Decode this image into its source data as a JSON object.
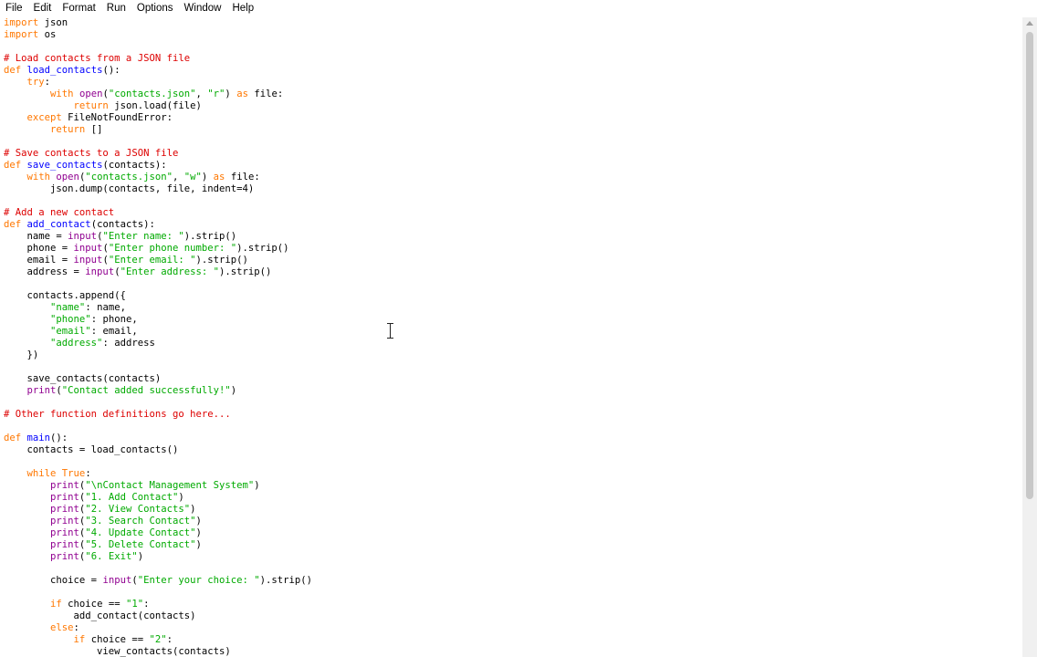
{
  "menu": [
    "File",
    "Edit",
    "Format",
    "Run",
    "Options",
    "Window",
    "Help"
  ],
  "code_lines": [
    [
      [
        "kw",
        "import"
      ],
      [
        "p",
        " json"
      ]
    ],
    [
      [
        "kw",
        "import"
      ],
      [
        "p",
        " os"
      ]
    ],
    [],
    [
      [
        "cm",
        "# Load contacts from a JSON file"
      ]
    ],
    [
      [
        "kw",
        "def"
      ],
      [
        "p",
        " "
      ],
      [
        "fn",
        "load_contacts"
      ],
      [
        "p",
        "():"
      ]
    ],
    [
      [
        "p",
        "    "
      ],
      [
        "kw",
        "try"
      ],
      [
        "p",
        ":"
      ]
    ],
    [
      [
        "p",
        "        "
      ],
      [
        "kw",
        "with"
      ],
      [
        "p",
        " "
      ],
      [
        "bi",
        "open"
      ],
      [
        "p",
        "("
      ],
      [
        "st",
        "\"contacts.json\""
      ],
      [
        "p",
        ", "
      ],
      [
        "st",
        "\"r\""
      ],
      [
        "p",
        ") "
      ],
      [
        "kw",
        "as"
      ],
      [
        "p",
        " file:"
      ]
    ],
    [
      [
        "p",
        "            "
      ],
      [
        "kw",
        "return"
      ],
      [
        "p",
        " json.load(file)"
      ]
    ],
    [
      [
        "p",
        "    "
      ],
      [
        "kw",
        "except"
      ],
      [
        "p",
        " FileNotFoundError:"
      ]
    ],
    [
      [
        "p",
        "        "
      ],
      [
        "kw",
        "return"
      ],
      [
        "p",
        " []"
      ]
    ],
    [],
    [
      [
        "cm",
        "# Save contacts to a JSON file"
      ]
    ],
    [
      [
        "kw",
        "def"
      ],
      [
        "p",
        " "
      ],
      [
        "fn",
        "save_contacts"
      ],
      [
        "p",
        "(contacts):"
      ]
    ],
    [
      [
        "p",
        "    "
      ],
      [
        "kw",
        "with"
      ],
      [
        "p",
        " "
      ],
      [
        "bi",
        "open"
      ],
      [
        "p",
        "("
      ],
      [
        "st",
        "\"contacts.json\""
      ],
      [
        "p",
        ", "
      ],
      [
        "st",
        "\"w\""
      ],
      [
        "p",
        ") "
      ],
      [
        "kw",
        "as"
      ],
      [
        "p",
        " file:"
      ]
    ],
    [
      [
        "p",
        "        json.dump(contacts, file, indent=4)"
      ]
    ],
    [],
    [
      [
        "cm",
        "# Add a new contact"
      ]
    ],
    [
      [
        "kw",
        "def"
      ],
      [
        "p",
        " "
      ],
      [
        "fn",
        "add_contact"
      ],
      [
        "p",
        "(contacts):"
      ]
    ],
    [
      [
        "p",
        "    name = "
      ],
      [
        "bi",
        "input"
      ],
      [
        "p",
        "("
      ],
      [
        "st",
        "\"Enter name: \""
      ],
      [
        "p",
        ").strip()"
      ]
    ],
    [
      [
        "p",
        "    phone = "
      ],
      [
        "bi",
        "input"
      ],
      [
        "p",
        "("
      ],
      [
        "st",
        "\"Enter phone number: \""
      ],
      [
        "p",
        ").strip()"
      ]
    ],
    [
      [
        "p",
        "    email = "
      ],
      [
        "bi",
        "input"
      ],
      [
        "p",
        "("
      ],
      [
        "st",
        "\"Enter email: \""
      ],
      [
        "p",
        ").strip()"
      ]
    ],
    [
      [
        "p",
        "    address = "
      ],
      [
        "bi",
        "input"
      ],
      [
        "p",
        "("
      ],
      [
        "st",
        "\"Enter address: \""
      ],
      [
        "p",
        ").strip()"
      ]
    ],
    [],
    [
      [
        "p",
        "    contacts.append({"
      ]
    ],
    [
      [
        "p",
        "        "
      ],
      [
        "st",
        "\"name\""
      ],
      [
        "p",
        ": name,"
      ]
    ],
    [
      [
        "p",
        "        "
      ],
      [
        "st",
        "\"phone\""
      ],
      [
        "p",
        ": phone,"
      ]
    ],
    [
      [
        "p",
        "        "
      ],
      [
        "st",
        "\"email\""
      ],
      [
        "p",
        ": email,"
      ]
    ],
    [
      [
        "p",
        "        "
      ],
      [
        "st",
        "\"address\""
      ],
      [
        "p",
        ": address"
      ]
    ],
    [
      [
        "p",
        "    })"
      ]
    ],
    [],
    [
      [
        "p",
        "    save_contacts(contacts)"
      ]
    ],
    [
      [
        "p",
        "    "
      ],
      [
        "bi",
        "print"
      ],
      [
        "p",
        "("
      ],
      [
        "st",
        "\"Contact added successfully!\""
      ],
      [
        "p",
        ")"
      ]
    ],
    [],
    [
      [
        "cm",
        "# Other function definitions go here..."
      ]
    ],
    [],
    [
      [
        "kw",
        "def"
      ],
      [
        "p",
        " "
      ],
      [
        "fn",
        "main"
      ],
      [
        "p",
        "():"
      ]
    ],
    [
      [
        "p",
        "    contacts = load_contacts()"
      ]
    ],
    [],
    [
      [
        "p",
        "    "
      ],
      [
        "kw",
        "while"
      ],
      [
        "p",
        " "
      ],
      [
        "kw",
        "True"
      ],
      [
        "p",
        ":"
      ]
    ],
    [
      [
        "p",
        "        "
      ],
      [
        "bi",
        "print"
      ],
      [
        "p",
        "("
      ],
      [
        "st",
        "\"\\nContact Management System\""
      ],
      [
        "p",
        ")"
      ]
    ],
    [
      [
        "p",
        "        "
      ],
      [
        "bi",
        "print"
      ],
      [
        "p",
        "("
      ],
      [
        "st",
        "\"1. Add Contact\""
      ],
      [
        "p",
        ")"
      ]
    ],
    [
      [
        "p",
        "        "
      ],
      [
        "bi",
        "print"
      ],
      [
        "p",
        "("
      ],
      [
        "st",
        "\"2. View Contacts\""
      ],
      [
        "p",
        ")"
      ]
    ],
    [
      [
        "p",
        "        "
      ],
      [
        "bi",
        "print"
      ],
      [
        "p",
        "("
      ],
      [
        "st",
        "\"3. Search Contact\""
      ],
      [
        "p",
        ")"
      ]
    ],
    [
      [
        "p",
        "        "
      ],
      [
        "bi",
        "print"
      ],
      [
        "p",
        "("
      ],
      [
        "st",
        "\"4. Update Contact\""
      ],
      [
        "p",
        ")"
      ]
    ],
    [
      [
        "p",
        "        "
      ],
      [
        "bi",
        "print"
      ],
      [
        "p",
        "("
      ],
      [
        "st",
        "\"5. Delete Contact\""
      ],
      [
        "p",
        ")"
      ]
    ],
    [
      [
        "p",
        "        "
      ],
      [
        "bi",
        "print"
      ],
      [
        "p",
        "("
      ],
      [
        "st",
        "\"6. Exit\""
      ],
      [
        "p",
        ")"
      ]
    ],
    [],
    [
      [
        "p",
        "        choice = "
      ],
      [
        "bi",
        "input"
      ],
      [
        "p",
        "("
      ],
      [
        "st",
        "\"Enter your choice: \""
      ],
      [
        "p",
        ").strip()"
      ]
    ],
    [],
    [
      [
        "p",
        "        "
      ],
      [
        "kw",
        "if"
      ],
      [
        "p",
        " choice == "
      ],
      [
        "st",
        "\"1\""
      ],
      [
        "p",
        ":"
      ]
    ],
    [
      [
        "p",
        "            add_contact(contacts)"
      ]
    ],
    [
      [
        "p",
        "        "
      ],
      [
        "kw",
        "else"
      ],
      [
        "p",
        ":"
      ]
    ],
    [
      [
        "p",
        "            "
      ],
      [
        "kw",
        "if"
      ],
      [
        "p",
        " choice == "
      ],
      [
        "st",
        "\"2\""
      ],
      [
        "p",
        ":"
      ]
    ],
    [
      [
        "p",
        "                view_contacts(contacts)"
      ]
    ]
  ],
  "colors": {
    "keyword": "#ff7700",
    "definition": "#0000ff",
    "builtin": "#900090",
    "string": "#00aa00",
    "comment": "#dd0000"
  }
}
